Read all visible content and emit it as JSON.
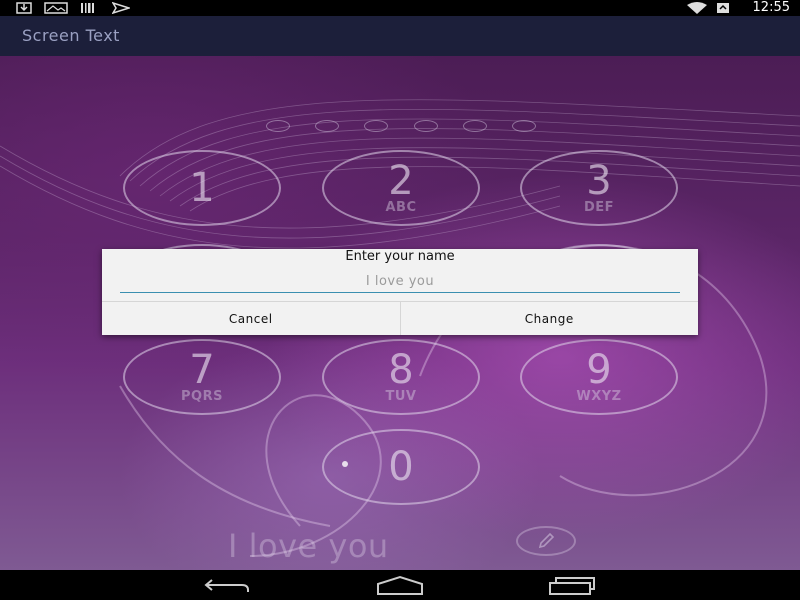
{
  "status_bar": {
    "time": "12:55",
    "left_icons": [
      "download-icon",
      "photo-icon",
      "barcode-icon",
      "send-icon"
    ],
    "right_icons": [
      "wifi-icon",
      "battery-icon"
    ]
  },
  "app_bar": {
    "title": "Screen Text"
  },
  "lock_screen": {
    "pin_dot_count": 6,
    "keys": [
      {
        "digit": "1",
        "letters": ""
      },
      {
        "digit": "2",
        "letters": "ABC"
      },
      {
        "digit": "3",
        "letters": "DEF"
      },
      {
        "digit": "7",
        "letters": "PQRS"
      },
      {
        "digit": "8",
        "letters": "TUV"
      },
      {
        "digit": "9",
        "letters": "WXYZ"
      },
      {
        "digit": "0",
        "letters": ""
      }
    ],
    "screen_text": "I love you"
  },
  "dialog": {
    "title": "Enter your name",
    "input_value": "I love you",
    "cancel_label": "Cancel",
    "change_label": "Change"
  },
  "nav_bar": {
    "buttons": [
      "back-icon",
      "home-icon",
      "recent-apps-icon"
    ]
  }
}
